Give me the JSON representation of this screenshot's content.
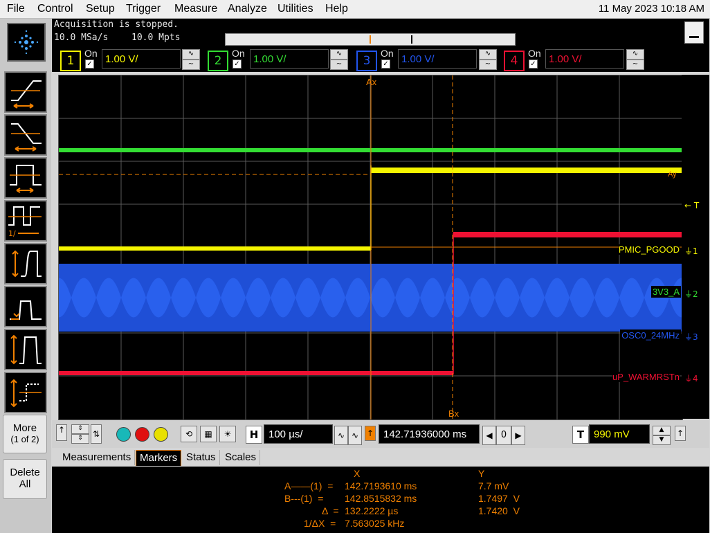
{
  "menu": {
    "items": [
      "File",
      "Control",
      "Setup",
      "Trigger",
      "Measure",
      "Analyze",
      "Utilities",
      "Help"
    ],
    "datetime": "11 May 2023 10:18 AM"
  },
  "acquisition": {
    "status": "Acquisition is stopped.",
    "sample_rate": "10.0 MSa/s",
    "memory_depth": "10.0 Mpts"
  },
  "left_panel": {
    "more_label": "More",
    "more_page": "(1 of 2)",
    "delete_label": "Delete",
    "delete_label2": "All"
  },
  "channels": [
    {
      "number": "1",
      "on_label": "On",
      "scale": "1.00 V/",
      "color": "#f5f500"
    },
    {
      "number": "2",
      "on_label": "On",
      "scale": "1.00 V/",
      "color": "#33dd33"
    },
    {
      "number": "3",
      "on_label": "On",
      "scale": "1.00 V/",
      "color": "#2255ee"
    },
    {
      "number": "4",
      "on_label": "On",
      "scale": "1.00 V/",
      "color": "#ee1133"
    }
  ],
  "waveform_labels": {
    "ch1": "PMIC_PGOOD",
    "ch2": "3V3_A",
    "ch3": "OSC0_24MHz",
    "ch4": "uP_WARMRSTn",
    "ref_1": "1",
    "ref_2": "2",
    "ref_3": "3",
    "ref_4": "4",
    "marker_a": "Ax",
    "marker_b": "Bx",
    "marker_ay": "Ay",
    "trigger": "T"
  },
  "controls": {
    "horizontal_label": "H",
    "time_per_div": "100 µs/",
    "delay": "142.71936000 ms",
    "delay_step": "0",
    "trigger_label": "T",
    "trigger_level": "990 mV"
  },
  "tabs": [
    {
      "label": "Measurements",
      "active": false
    },
    {
      "label": "Markers",
      "active": true
    },
    {
      "label": "Status",
      "active": false
    },
    {
      "label": "Scales",
      "active": false
    }
  ],
  "markers": {
    "header_x": "X",
    "header_y": "Y",
    "rows": [
      {
        "label": "A——(1)  =",
        "x": "142.7193610 ms",
        "y": "7.7 mV"
      },
      {
        "label": "B---(1)  =",
        "x": "142.8515832 ms",
        "y": "1.7497  V"
      },
      {
        "label": "Δ  =",
        "x": "132.2222 µs",
        "y": "1.7420  V"
      },
      {
        "label": "1/ΔX  =",
        "x": "7.563025 kHz",
        "y": ""
      }
    ]
  },
  "colors": {
    "marker": "#f08000",
    "grid": "#6a6a6a"
  }
}
